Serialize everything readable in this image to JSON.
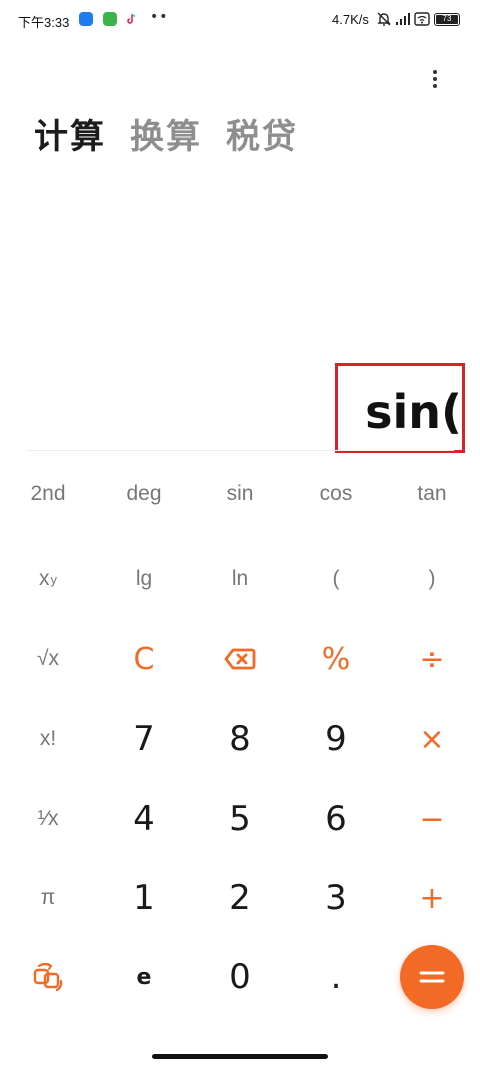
{
  "status_bar": {
    "time": "下午3:33",
    "dots": "••",
    "net_speed": "4.7K/s",
    "battery": "73"
  },
  "tabs": [
    {
      "label": "计算",
      "active": true
    },
    {
      "label": "换算",
      "active": false
    },
    {
      "label": "税贷",
      "active": false
    }
  ],
  "display": {
    "expression": "sin("
  },
  "keypad": {
    "row1": [
      "2nd",
      "deg",
      "sin",
      "cos",
      "tan"
    ],
    "row2": {
      "power_base": "x",
      "power_exp": "y",
      "lg": "lg",
      "ln": "ln",
      "open_paren": "(",
      "close_paren": ")"
    },
    "row3": {
      "sqrt": "√x",
      "clear": "C",
      "percent": "%",
      "divide": "÷"
    },
    "row4": {
      "factorial": "x!",
      "d7": "7",
      "d8": "8",
      "d9": "9",
      "multiply": "×"
    },
    "row5": {
      "reciprocal": "¹⁄x",
      "d4": "4",
      "d5": "5",
      "d6": "6",
      "minus": "−"
    },
    "row6": {
      "pi": "π",
      "d1": "1",
      "d2": "2",
      "d3": "3",
      "plus": "+"
    },
    "row7": {
      "e": "e",
      "d0": "0",
      "dot": "."
    }
  },
  "colors": {
    "accent": "#f26a25",
    "highlight_box": "#d9232b"
  },
  "icons": {
    "backspace": "backspace-icon",
    "switch": "switch-mode-icon",
    "equals": "equals-icon",
    "menu": "more-vertical-icon"
  }
}
